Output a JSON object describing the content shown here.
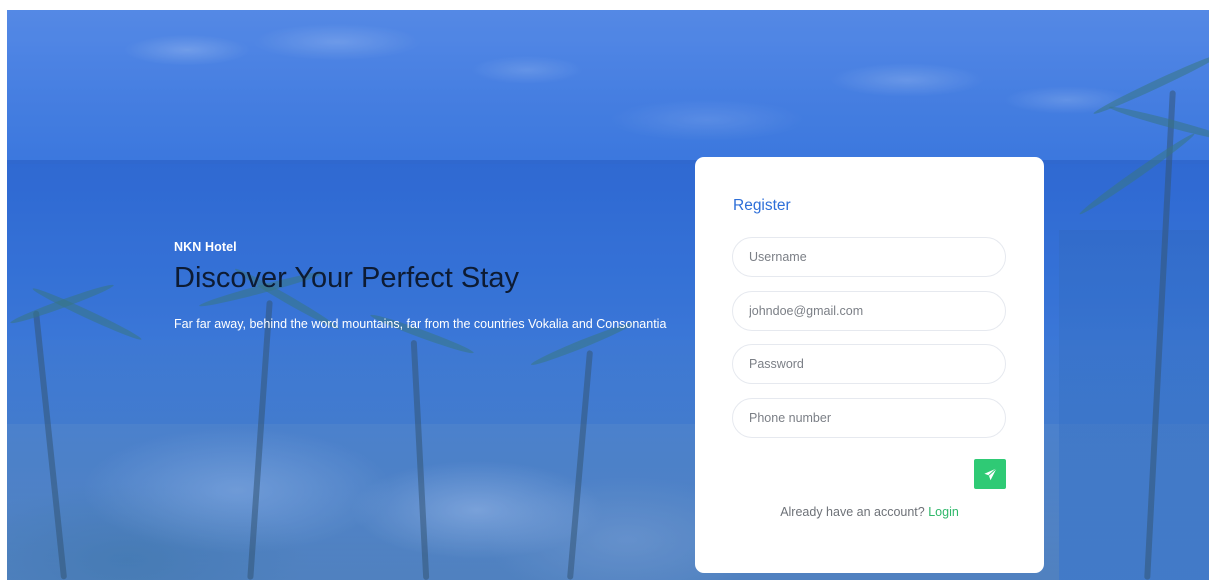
{
  "hero": {
    "brand": "NKN Hotel",
    "headline": "Discover Your Perfect Stay",
    "tagline": "Far far away, behind the word mountains, far from the countries Vokalia and Consonantia"
  },
  "register": {
    "title": "Register",
    "fields": {
      "username_placeholder": "Username",
      "email_placeholder": "johndoe@gmail.com",
      "password_placeholder": "Password",
      "phone_placeholder": "Phone number"
    },
    "submit_icon": "paper-plane-icon",
    "login_prompt": "Already have an account?",
    "login_link": "Login"
  },
  "colors": {
    "accent_blue": "#2e6fd8",
    "accent_green": "#2fca75",
    "headline": "#0d1b33"
  }
}
